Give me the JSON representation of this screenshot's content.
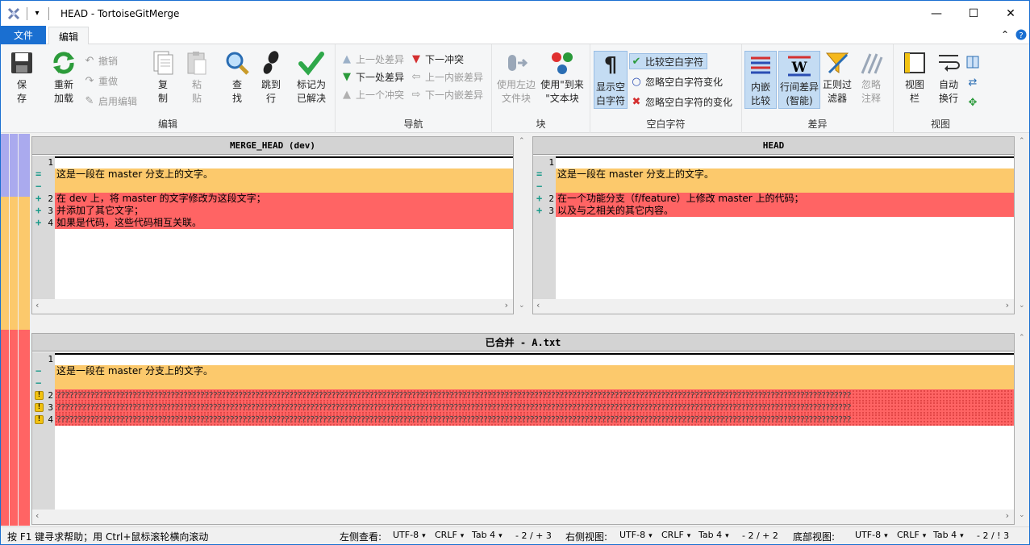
{
  "window": {
    "title": "HEAD - TortoiseGitMerge",
    "minimize": "—",
    "maximize": "☐",
    "close": "✕"
  },
  "tabs": {
    "file": "文件",
    "edit": "编辑"
  },
  "ribbon": {
    "edit_group": {
      "label": "编辑",
      "save": "保存",
      "save2": "存",
      "save1": "保",
      "reload1": "重新",
      "reload2": "加载",
      "undo": "撤销",
      "redo": "重做",
      "enable_edit": "启用编辑",
      "copy1": "复",
      "copy2": "制",
      "paste1": "粘",
      "paste2": "贴",
      "find1": "查",
      "find2": "找",
      "goto1": "跳到",
      "goto2": "行",
      "mark1": "标记为",
      "mark2": "已解决"
    },
    "nav_group": {
      "label": "导航",
      "prev_diff": "上一处差异",
      "next_diff": "下一处差异",
      "prev_conflict": "上一个冲突",
      "next_conflict": "下一冲突",
      "prev_inline": "上一内嵌差异",
      "next_inline": "下一内嵌差异"
    },
    "block_group": {
      "label": "块",
      "use_left1": "使用左边",
      "use_left2": "文件块",
      "use_then1": "使用\"到来",
      "use_then2": "\"文本块"
    },
    "ws_group": {
      "label": "空白字符",
      "show_ws1": "显示空",
      "show_ws2": "白字符",
      "compare_ws": "比较空白字符",
      "ignore_ws_change": "忽略空白字符变化",
      "ignore_all_ws": "忽略空白字符的变化"
    },
    "diff_group": {
      "label": "差异",
      "inline1": "内嵌",
      "inline2": "比较",
      "linediff1": "行间差异",
      "linediff2": "(智能)",
      "regex1": "正则过",
      "regex2": "滤器",
      "ignore_comments1": "忽略",
      "ignore_comments2": "注释"
    },
    "view_group": {
      "label": "视图",
      "viewbar1": "视图",
      "viewbar2": "栏",
      "wrap1": "自动",
      "wrap2": "换行"
    }
  },
  "left_pane": {
    "header": "MERGE_HEAD (dev)",
    "lines": [
      {
        "num": "1",
        "mark": "",
        "text": ""
      },
      {
        "num": "",
        "mark": "=",
        "text": "这是一段在 master 分支上的文字。"
      },
      {
        "num": "",
        "mark": "−",
        "text": ""
      },
      {
        "num": "2",
        "mark": "+",
        "text": "在 dev 上，将 master 的文字修改为这段文字；"
      },
      {
        "num": "3",
        "mark": "+",
        "text": "并添加了其它文字；"
      },
      {
        "num": "4",
        "mark": "+",
        "text": "如果是代码，这些代码相互关联。"
      }
    ]
  },
  "right_pane": {
    "header": "HEAD",
    "lines": [
      {
        "num": "1",
        "mark": "",
        "text": ""
      },
      {
        "num": "",
        "mark": "=",
        "text": "这是一段在 master 分支上的文字。"
      },
      {
        "num": "",
        "mark": "−",
        "text": ""
      },
      {
        "num": "2",
        "mark": "+",
        "text": "在一个功能分支（f/feature）上修改 master 上的代码；"
      },
      {
        "num": "3",
        "mark": "+",
        "text": "以及与之相关的其它内容。"
      }
    ]
  },
  "bottom_pane": {
    "header": "已合并 - A.txt",
    "lines": [
      {
        "num": "1",
        "mark": "",
        "text": ""
      },
      {
        "num": "",
        "mark": "−",
        "text": "这是一段在 master 分支上的文字。"
      },
      {
        "num": "",
        "mark": "−",
        "text": ""
      },
      {
        "num": "2",
        "mark": "!",
        "text": "????????????????????????????????????????????????????????????????????????????????????????????????????????????????????????????????????????????????????????????????????????????????????????????"
      },
      {
        "num": "3",
        "mark": "!",
        "text": "????????????????????????????????????????????????????????????????????????????????????????????????????????????????????????????????????????????????????????????????????????????????????????????"
      },
      {
        "num": "4",
        "mark": "!",
        "text": "????????????????????????????????????????????????????????????????????????????????????????????????????????????????????????????????????????????????????????????????????????????????????????????"
      }
    ]
  },
  "status": {
    "help": "按 F1 键寻求帮助；用 Ctrl+鼠标滚轮横向滚动",
    "left_view": "左侧查看:",
    "right_view": "右侧视图:",
    "bottom_view": "底部视图:",
    "encoding": "UTF-8",
    "eol": "CRLF",
    "tab": "Tab 4",
    "left_count": "- 2 / + 3",
    "right_count": "- 2 / + 2",
    "bottom_count": "- 2 / ! 3"
  },
  "colors": {
    "accent": "#1a6fd1",
    "same": "#fcc96c",
    "diff": "#ff6464",
    "loc_blue": "#aaaaee",
    "gutter": "#d9d9d9"
  }
}
